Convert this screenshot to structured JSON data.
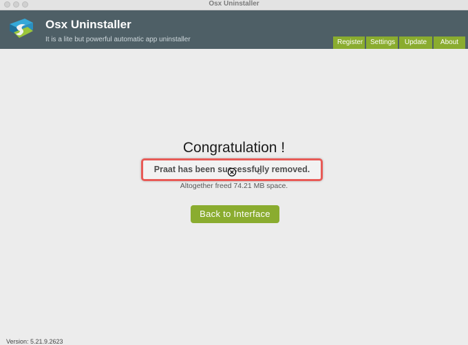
{
  "window": {
    "title": "Osx Uninstaller"
  },
  "header": {
    "app_title": "Osx Uninstaller",
    "subtitle": "It is a lite but powerful automatic app uninstaller",
    "nav": [
      {
        "label": "Register"
      },
      {
        "label": "Settings"
      },
      {
        "label": "Update"
      },
      {
        "label": "About"
      }
    ]
  },
  "main": {
    "heading": "Congratulation !",
    "message": "Praat has been successfully removed.",
    "freed_text": "Altogether freed 74.21 MB space.",
    "back_button": "Back to Interface"
  },
  "footer": {
    "version": "Version: 5.21.9.2623"
  },
  "colors": {
    "header_bg": "#4e5f66",
    "accent_green": "#8aac2f",
    "highlight_red": "#e85a56",
    "background": "#ececec"
  }
}
